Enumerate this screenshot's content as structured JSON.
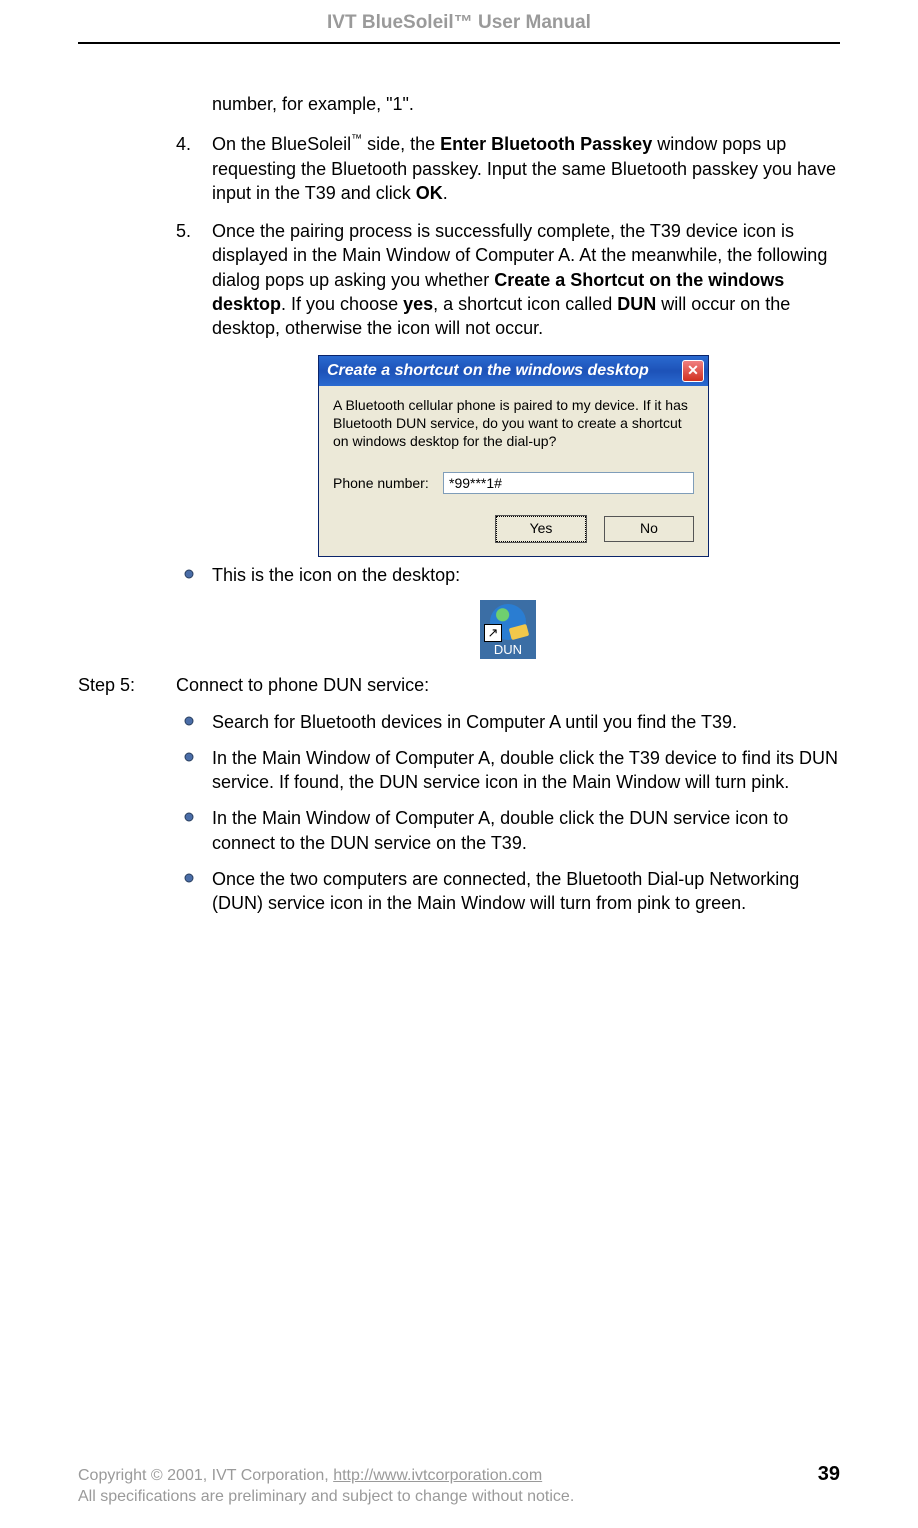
{
  "header": {
    "title": "IVT BlueSoleil™ User Manual"
  },
  "frag": {
    "text": "number, for example, \"1\"."
  },
  "item4": {
    "num": "4.",
    "pre": "On the BlueSoleil",
    "tm": "™",
    "mid1": " side, the ",
    "b1": "Enter Bluetooth Passkey",
    "mid2": " window pops up requesting the Bluetooth passkey. Input the same Bluetooth passkey you have input in the T39 and click ",
    "b2": "OK",
    "end": "."
  },
  "item5": {
    "num": "5.",
    "pre": "Once the pairing process is successfully complete, the T39 device icon is displayed in the Main Window of Computer A. At the meanwhile, the following dialog pops up asking you whether ",
    "b1": "Create a Shortcut on the windows desktop",
    "mid": ". If you choose ",
    "b2": "yes",
    "mid2": ", a shortcut icon called ",
    "b3": "DUN",
    "end": " will occur on the desktop, otherwise the icon will not occur."
  },
  "dialog": {
    "title": "Create a shortcut on the windows desktop",
    "message": "A Bluetooth cellular phone is paired to my device.  If it has Bluetooth DUN service, do you want to create a shortcut on windows desktop for the dial-up?",
    "phone_label": "Phone number:",
    "phone_value": "*99***1#",
    "yes": "Yes",
    "no": "No"
  },
  "bullet_icon": {
    "text": "This is the icon on the desktop:"
  },
  "desktop_icon": {
    "label": "DUN",
    "arrow": "↗"
  },
  "step5": {
    "label": "Step 5:",
    "text": "Connect to phone DUN service:"
  },
  "bullets": {
    "b1": "Search for Bluetooth devices in Computer A until you find the T39.",
    "b2": "In the Main Window of Computer A, double click the T39 device to find its DUN service. If found, the DUN service icon in the Main Window will turn pink.",
    "b3": "In the Main Window of Computer A, double click the DUN service icon to connect to the DUN service on the T39.",
    "b4": "Once the two computers are connected, the Bluetooth Dial-up Networking (DUN) service icon in the Main Window will turn from pink to green."
  },
  "footer": {
    "copy_pre": "Copyright © 2001, IVT Corporation, ",
    "link": "http://www.ivtcorporation.com",
    "page": "39",
    "line2": "All specifications are preliminary and subject to change without notice."
  }
}
